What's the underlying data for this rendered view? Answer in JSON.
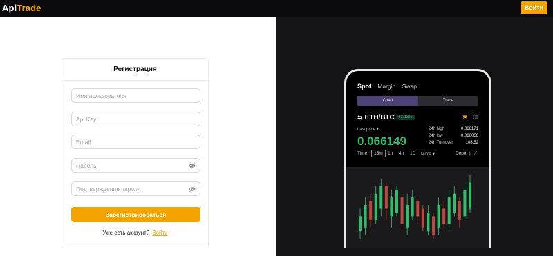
{
  "header": {
    "logo_part1": "Api",
    "logo_part2": "Trade",
    "login_button": "Войти"
  },
  "form": {
    "title": "Регистрация",
    "username_placeholder": "Имя пользователя",
    "apikey_placeholder": "Api Key",
    "email_placeholder": "Email",
    "password_placeholder": "Пароль",
    "password_confirm_placeholder": "Подтверждение пароля",
    "submit_label": "Зарегистрироваться",
    "have_account_text": "Уже есть аккаунт?",
    "login_link": "Войти"
  },
  "promo": {
    "tabs": [
      "Spot",
      "Margin",
      "Swap"
    ],
    "segments": [
      "Chart",
      "Trade"
    ],
    "pair_icon": "⇆",
    "pair": "ETH/BTC",
    "change": "+3.13%",
    "last_price_label": "Last price ▾",
    "last_price": "0.066149",
    "stats": [
      {
        "label": "24h high",
        "value": "0.066171"
      },
      {
        "label": "24h low",
        "value": "0.066056"
      },
      {
        "label": "24h Turnover",
        "value": "108.52"
      }
    ],
    "timeframes": {
      "time": "Time",
      "selected": "15m",
      "t1h": "1h",
      "t4h": "4h",
      "t1d": "1D",
      "more": "More ▾",
      "depth": "Depth",
      "sep": "|",
      "expand": "⤢"
    },
    "colors": {
      "up": "#2fbf6b",
      "down": "#c2463f",
      "accent": "#f5a300"
    },
    "candles": [
      {
        "d": "up",
        "lo": 0.066,
        "o": 0.06602,
        "c": 0.06606,
        "hi": 0.06608
      },
      {
        "d": "up",
        "lo": 0.06601,
        "o": 0.06603,
        "c": 0.06609,
        "hi": 0.06611
      },
      {
        "d": "down",
        "lo": 0.06603,
        "o": 0.0661,
        "c": 0.06605,
        "hi": 0.06612
      },
      {
        "d": "up",
        "lo": 0.06604,
        "o": 0.06605,
        "c": 0.06612,
        "hi": 0.06614
      },
      {
        "d": "up",
        "lo": 0.06606,
        "o": 0.06608,
        "c": 0.06614,
        "hi": 0.06616
      },
      {
        "d": "down",
        "lo": 0.06605,
        "o": 0.06614,
        "c": 0.06608,
        "hi": 0.06615
      },
      {
        "d": "up",
        "lo": 0.06603,
        "o": 0.06606,
        "c": 0.06611,
        "hi": 0.06613
      },
      {
        "d": "up",
        "lo": 0.06606,
        "o": 0.06607,
        "c": 0.06613,
        "hi": 0.06614
      },
      {
        "d": "down",
        "lo": 0.06602,
        "o": 0.06611,
        "c": 0.06604,
        "hi": 0.06612
      },
      {
        "d": "up",
        "lo": 0.06601,
        "o": 0.06603,
        "c": 0.06609,
        "hi": 0.06612
      },
      {
        "d": "up",
        "lo": 0.06605,
        "o": 0.06606,
        "c": 0.06611,
        "hi": 0.06613
      },
      {
        "d": "down",
        "lo": 0.06604,
        "o": 0.0661,
        "c": 0.06606,
        "hi": 0.06611
      },
      {
        "d": "down",
        "lo": 0.06602,
        "o": 0.06608,
        "c": 0.06603,
        "hi": 0.06609
      },
      {
        "d": "up",
        "lo": 0.06601,
        "o": 0.06602,
        "c": 0.06607,
        "hi": 0.06609
      },
      {
        "d": "down",
        "lo": 0.066,
        "o": 0.06606,
        "c": 0.06601,
        "hi": 0.06607
      },
      {
        "d": "up",
        "lo": 0.06601,
        "o": 0.06603,
        "c": 0.06609,
        "hi": 0.06611
      },
      {
        "d": "down",
        "lo": 0.06603,
        "o": 0.06608,
        "c": 0.06604,
        "hi": 0.0661
      },
      {
        "d": "up",
        "lo": 0.06602,
        "o": 0.06604,
        "c": 0.06611,
        "hi": 0.06613
      },
      {
        "d": "up",
        "lo": 0.06606,
        "o": 0.06607,
        "c": 0.06612,
        "hi": 0.06614
      },
      {
        "d": "down",
        "lo": 0.06603,
        "o": 0.0661,
        "c": 0.06605,
        "hi": 0.06611
      },
      {
        "d": "up",
        "lo": 0.06605,
        "o": 0.06606,
        "c": 0.06613,
        "hi": 0.06615
      },
      {
        "d": "up",
        "lo": 0.06607,
        "o": 0.06608,
        "c": 0.06615,
        "hi": 0.06617
      }
    ],
    "candle_range": [
      0.06598,
      0.06618
    ]
  }
}
